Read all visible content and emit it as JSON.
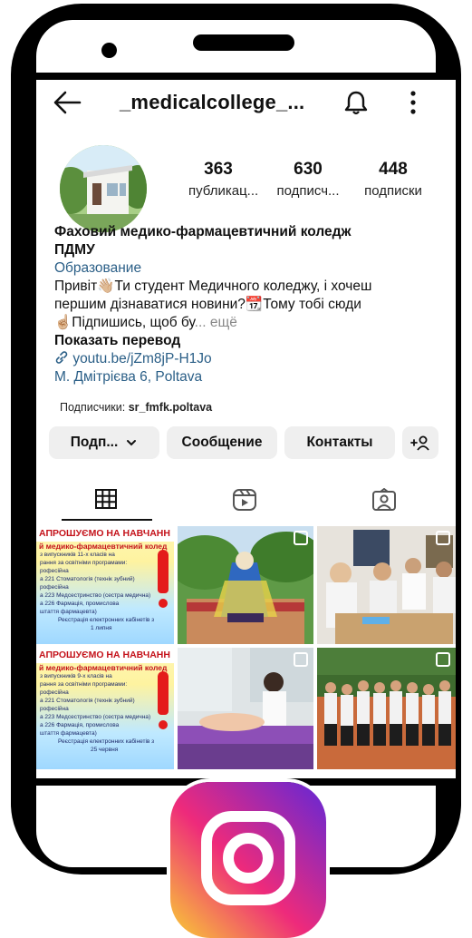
{
  "header": {
    "username": "_medicalcollege_...",
    "back_icon": "arrow-left-icon",
    "bell_icon": "bell-icon",
    "menu_icon": "more-vertical-icon"
  },
  "stats": [
    {
      "count": "363",
      "label": "публикац..."
    },
    {
      "count": "630",
      "label": "подписч..."
    },
    {
      "count": "448",
      "label": "подписки"
    }
  ],
  "bio": {
    "name_line1": "Фаховий медико-фармацевтичний коледж",
    "name_line2": "ПДМУ",
    "category": "Образование",
    "line1": "Привіт👋🏼Ти студент Медичного коледжу, і хочеш",
    "line2": "першим дізнаватися новини?📆Тому тобі сюди",
    "line3": "☝🏼Підпишись, щоб бу",
    "more": "... ещё",
    "translate": "Показать перевод",
    "link": "youtu.be/jZm8jP-H1Jo",
    "address": "М. Дмітрієва 6, Poltava"
  },
  "followed_by": {
    "label": "Подписчики:",
    "name": "sr_fmfk.poltava"
  },
  "buttons": {
    "follow": "Подп...",
    "message": "Сообщение",
    "contacts": "Контакты",
    "add_person": "+ዖ"
  },
  "tabs": [
    "grid-icon",
    "reels-icon",
    "tagged-icon"
  ],
  "posts": {
    "poster_title": "АПРОШУЄМО НА НАВЧАНН",
    "poster_subtitle": "й медико-фармацевтичний колед",
    "poster1_lines": [
      "з випускників 11-х класів на",
      "рання за освітніми програмами:",
      "рофесійна",
      "а 221 Стоматологія (технік зубний)",
      "рофесійна",
      "а 223 Медсестринство (сестра медична)",
      "а 226 Фармація, промислова",
      "штаття фармацевта)",
      "Реєстрація електронних кабінетів з",
      "1 липня"
    ],
    "poster2_lines": [
      "з випускників 9-х класів на",
      "рання за освітніми програмами:",
      "рофесійна",
      "а 221 Стоматологія (технік зубний)",
      "рофесійна",
      "а 223 Медсестринство (сестра медична)",
      "а 226 Фармація, промислова",
      "штаття фармацевта)",
      "Реєстрація електронних кабінетів з",
      "25 червня"
    ]
  },
  "colors": {
    "link": "#2b5f87",
    "button_bg": "#efefef",
    "poster_red": "#c4121a"
  }
}
